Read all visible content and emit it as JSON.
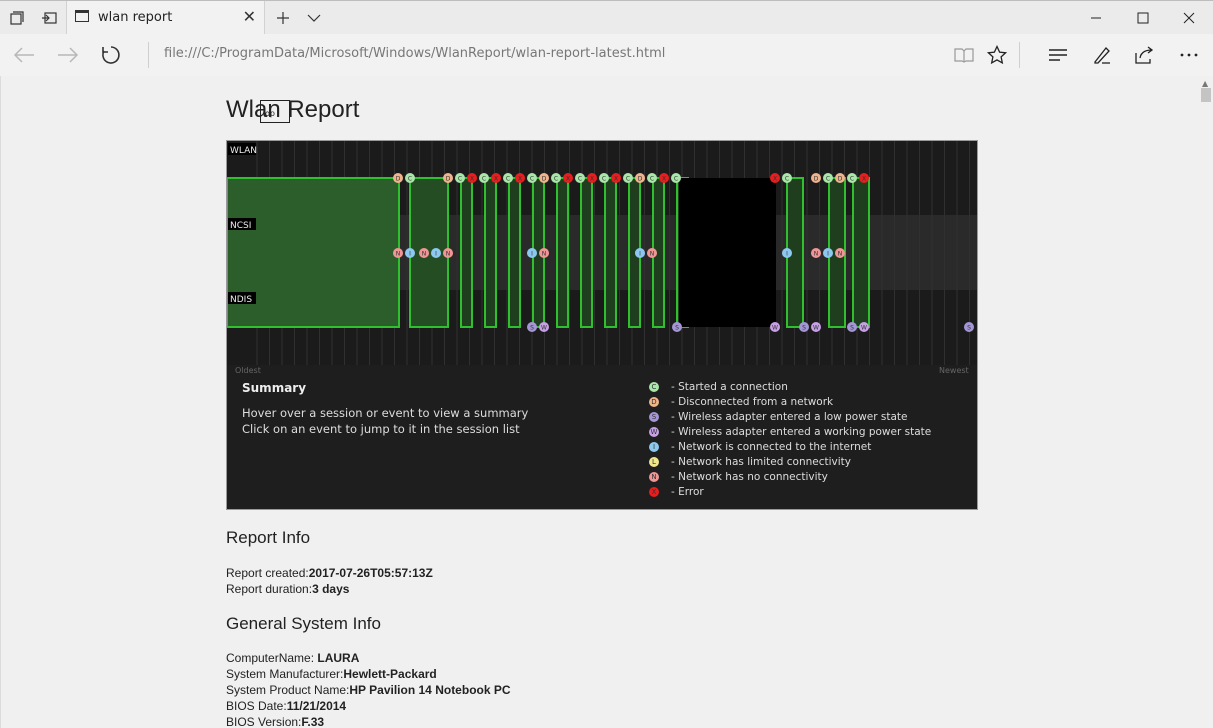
{
  "browser": {
    "tab_title": "wlan report",
    "url": "file:///C:/ProgramData/Microsoft/Windows/WlanReport/wlan-report-latest.html",
    "icons": [
      "tab-preview-icon",
      "set-aside-tabs-icon",
      "close-icon",
      "new-tab-icon",
      "chevron-down-icon",
      "minimize-icon",
      "maximize-icon",
      "close-window-icon",
      "back-icon",
      "forward-icon",
      "refresh-icon",
      "reading-view-icon",
      "favorites-star-icon",
      "hub-icon",
      "web-note-icon",
      "share-icon",
      "more-icon"
    ]
  },
  "page": {
    "title": "Wlan Report",
    "tooltip": "op",
    "chart": {
      "lanes": [
        "WLAN",
        "NCSI",
        "NDIS"
      ],
      "oldest": "Oldest",
      "newest": "Newest",
      "wlan_events": [
        "D",
        "C",
        "D",
        "C",
        "X",
        "C",
        "X",
        "C",
        "X",
        "C",
        "D",
        "C",
        "X",
        "C",
        "X",
        "C",
        "X",
        "C",
        "D",
        "C",
        "X",
        "C",
        "X",
        "C",
        "D",
        "C",
        "D",
        "C",
        "X"
      ],
      "ncsi_events": [
        "N",
        "I",
        "N",
        "I",
        "N",
        "I",
        "N",
        "I",
        "N",
        "I",
        "N",
        "I",
        "N"
      ],
      "ndis_events": [
        "S",
        "W",
        "S",
        "W",
        "S",
        "W",
        "S",
        "W",
        "S",
        "W",
        "W"
      ],
      "summary_title": "Summary",
      "summary_lines": [
        "Hover over a session or event to view a summary",
        "Click on an event to jump to it in the session list"
      ],
      "legend": [
        {
          "letter": "C",
          "text": "- Started a connection",
          "color": "#a9e6a9"
        },
        {
          "letter": "D",
          "text": "- Disconnected from a network",
          "color": "#f0b48c"
        },
        {
          "letter": "S",
          "text": "- Wireless adapter entered a low power state",
          "color": "#a596d6"
        },
        {
          "letter": "W",
          "text": "- Wireless adapter entered a working power state",
          "color": "#c8a0e6"
        },
        {
          "letter": "I",
          "text": "- Network is connected to the internet",
          "color": "#8cc8f0"
        },
        {
          "letter": "L",
          "text": "- Network has limited connectivity",
          "color": "#f0e68c"
        },
        {
          "letter": "N",
          "text": "- Network has no connectivity",
          "color": "#f09696"
        },
        {
          "letter": "X",
          "text": "- Error",
          "color": "#e61e1e"
        }
      ]
    },
    "report_info": {
      "heading": "Report Info",
      "created_label": "Report created:",
      "created_value": "2017-07-26T05:57:13Z",
      "duration_label": "Report duration:",
      "duration_value": "3 days"
    },
    "system_info": {
      "heading": "General System Info",
      "rows": [
        {
          "label": "ComputerName: ",
          "value": "LAURA"
        },
        {
          "label": "System Manufacturer:",
          "value": "Hewlett-Packard"
        },
        {
          "label": "System Product Name:",
          "value": "HP Pavilion 14 Notebook PC"
        },
        {
          "label": "BIOS Date:",
          "value": "11/21/2014"
        },
        {
          "label": "BIOS Version:",
          "value": "F.33"
        }
      ]
    }
  }
}
